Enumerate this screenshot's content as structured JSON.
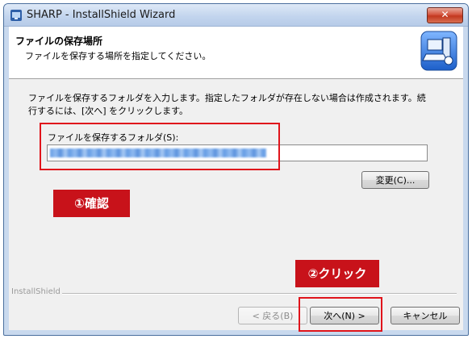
{
  "window": {
    "title": "SHARP - InstallShield Wizard",
    "close_label": "✕"
  },
  "header": {
    "title": "ファイルの保存場所",
    "subtitle": "ファイルを保存する場所を指定してください。"
  },
  "body": {
    "instruction": "ファイルを保存するフォルダを入力します。指定したフォルダが存在しない場合は作成されます。続行するには、[次へ] をクリックします。",
    "field_label": "ファイルを保存するフォルダ(S):",
    "change_button": "変更(C)..."
  },
  "footer": {
    "brand": "InstallShield",
    "back_button": "< 戻る(B)",
    "next_button": "次へ(N) >",
    "cancel_button": "キャンセル"
  },
  "annotations": {
    "confirm": "①確認",
    "click": "②クリック",
    "color": "#c8121a"
  },
  "icons": [
    "installer-app-icon",
    "computer-setup-icon",
    "close-icon"
  ]
}
